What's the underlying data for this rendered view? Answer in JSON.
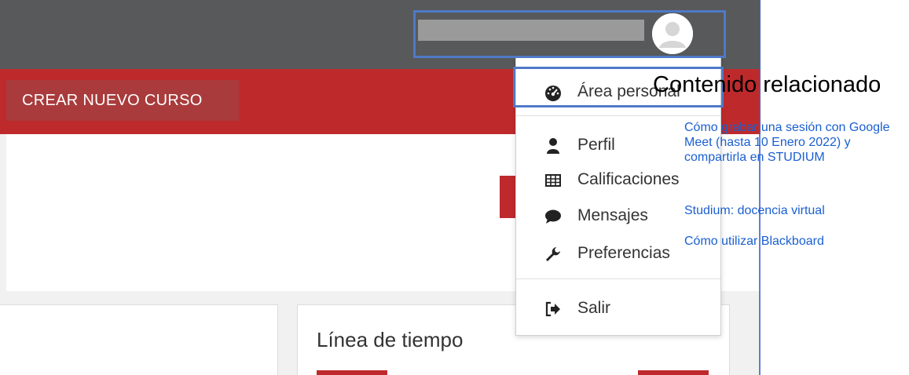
{
  "header": {
    "create_course_label": "CREAR NUEVO CURSO"
  },
  "user_menu": {
    "items": [
      {
        "label": "Área personal",
        "icon": "dashboard-icon"
      },
      {
        "label": "Perfil",
        "icon": "user-icon"
      },
      {
        "label": "Calificaciones",
        "icon": "table-icon"
      },
      {
        "label": "Mensajes",
        "icon": "comment-icon"
      },
      {
        "label": "Preferencias",
        "icon": "wrench-icon"
      },
      {
        "label": "Salir",
        "icon": "sign-out-icon"
      }
    ]
  },
  "timeline": {
    "title": "Línea de tiempo"
  },
  "related": {
    "heading": "Contenido relacionado",
    "links": [
      "Cómo grabar una sesión con Google Meet (hasta 10 Enero 2022) y compartirla en STUDIUM",
      "Studium: docencia virtual",
      "Cómo utilizar Blackboard"
    ]
  },
  "colors": {
    "navbar": "#58595b",
    "brand_red": "#be2a2c",
    "highlight": "#4f79c7",
    "link": "#1a5fd1"
  }
}
